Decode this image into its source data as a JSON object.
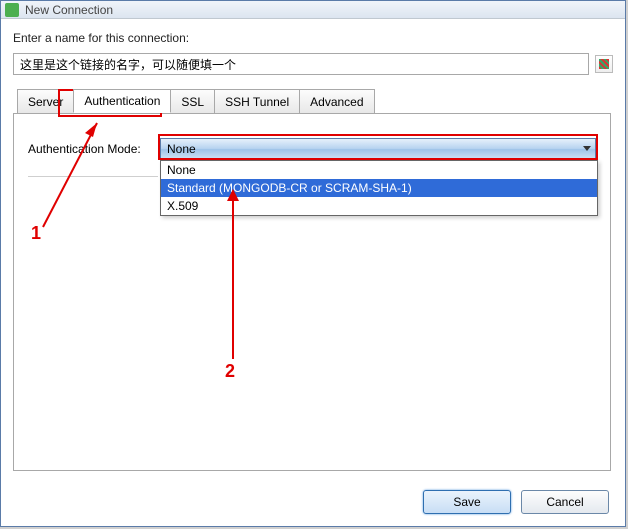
{
  "titlebar": {
    "title": "New Connection"
  },
  "prompt": "Enter a name for this connection:",
  "name_input_value": "这里是这个链接的名字，可以随便填一个",
  "tabs": {
    "server": "Server",
    "authentication": "Authentication",
    "ssl": "SSL",
    "ssh_tunnel": "SSH Tunnel",
    "advanced": "Advanced"
  },
  "auth": {
    "label": "Authentication Mode:",
    "selected": "None",
    "options": {
      "none": "None",
      "standard": "Standard (MONGODB-CR or SCRAM-SHA-1)",
      "x509": "X.509"
    }
  },
  "buttons": {
    "save": "Save",
    "cancel": "Cancel"
  },
  "annotations": {
    "n1": "1",
    "n2": "2"
  }
}
